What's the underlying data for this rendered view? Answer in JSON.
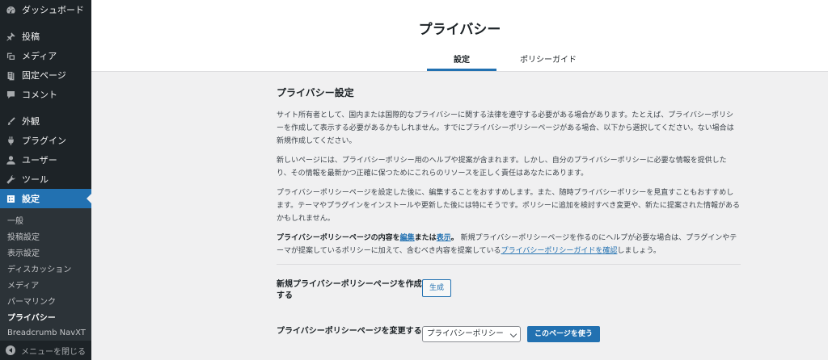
{
  "sidebar": {
    "items": [
      {
        "label": "ダッシュボード",
        "icon": "dashboard-icon"
      },
      {
        "label": "投稿",
        "icon": "pin-icon"
      },
      {
        "label": "メディア",
        "icon": "media-icon"
      },
      {
        "label": "固定ページ",
        "icon": "page-icon"
      },
      {
        "label": "コメント",
        "icon": "comment-icon"
      },
      {
        "label": "外観",
        "icon": "brush-icon"
      },
      {
        "label": "プラグイン",
        "icon": "plugin-icon"
      },
      {
        "label": "ユーザー",
        "icon": "user-icon"
      },
      {
        "label": "ツール",
        "icon": "wrench-icon"
      },
      {
        "label": "設定",
        "icon": "settings-icon"
      }
    ],
    "submenu": [
      "一般",
      "投稿設定",
      "表示設定",
      "ディスカッション",
      "メディア",
      "パーマリンク",
      "プライバシー",
      "Breadcrumb NavXT"
    ],
    "collapse_label": "メニューを閉じる",
    "active_color": "#2271b1"
  },
  "header": {
    "title": "プライバシー",
    "tabs": [
      "設定",
      "ポリシーガイド"
    ]
  },
  "main": {
    "section_title": "プライバシー設定",
    "p1": "サイト所有者として、国内または国際的なプライバシーに関する法律を遵守する必要がある場合があります。たとえば、プライバシーポリシーを作成して表示する必要があるかもしれません。すでにプライバシーポリシーページがある場合、以下から選択してください。ない場合は新規作成してください。",
    "p2": "新しいページには、プライバシーポリシー用のヘルプや提案が含まれます。しかし、自分のプライバシーポリシーに必要な情報を提供したり、その情報を最新かつ正確に保つためにこれらのリソースを正しく責任はあなたにあります。",
    "p3": "プライバシーポリシーページを設定した後に、編集することをおすすめします。また、随時プライバシーポリシーを見直すこともおすすめします。テーマやプラグインをインストールや更新した後には特にそうです。ポリシーに追加を検討すべき変更や、新たに提案された情報があるかもしれません。",
    "p4_strong": "プライバシーポリシーページの内容を",
    "p4_link_edit": "編集",
    "p4_mid": "または",
    "p4_link_view": "表示",
    "p4_strong_end": "。",
    "p4_rest": " 新規プライバシーポリシーページを作るのにヘルプが必要な場合は、プラグインやテーマが提案しているポリシーに加えて、含むべき内容を提案している",
    "p4_link_guide": "プライバシーポリシーガイドを確認",
    "p4_tail": "しましょう。",
    "create_label": "新規プライバシーポリシーページを作成する",
    "create_button": "生成",
    "change_label": "プライバシーポリシーページを変更する",
    "select_value": "プライバシーポリシー",
    "use_button": "このページを使う"
  }
}
